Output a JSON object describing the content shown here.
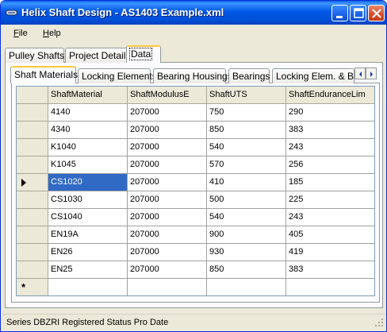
{
  "window": {
    "title": "Helix Shaft Design - AS1403 Example.xml"
  },
  "menu": [
    {
      "underline": "F",
      "rest": "ile"
    },
    {
      "underline": "H",
      "rest": "elp"
    }
  ],
  "outer_tabs": [
    {
      "label": "Pulley Shafts",
      "active": false
    },
    {
      "label": "Project Details",
      "active": false
    },
    {
      "label": "Data",
      "active": true
    }
  ],
  "inner_tabs": [
    {
      "label": "Shaft Materials",
      "active": true
    },
    {
      "label": "Locking Elements",
      "active": false
    },
    {
      "label": "Bearing Housings",
      "active": false
    },
    {
      "label": "Bearings",
      "active": false
    },
    {
      "label": "Locking Elem. & Brg",
      "active": false
    }
  ],
  "grid": {
    "columns": [
      "ShaftMaterial",
      "ShaftModulusE",
      "ShaftUTS",
      "ShaftEnduranceLim"
    ],
    "rows": [
      [
        "4140",
        "207000",
        "750",
        "290"
      ],
      [
        "4340",
        "207000",
        "850",
        "383"
      ],
      [
        "K1040",
        "207000",
        "540",
        "243"
      ],
      [
        "K1045",
        "207000",
        "570",
        "256"
      ],
      [
        "CS1020",
        "207000",
        "410",
        "185"
      ],
      [
        "CS1030",
        "207000",
        "500",
        "225"
      ],
      [
        "CS1040",
        "207000",
        "540",
        "243"
      ],
      [
        "EN19A",
        "207000",
        "900",
        "405"
      ],
      [
        "EN26",
        "207000",
        "930",
        "419"
      ],
      [
        "EN25",
        "207000",
        "850",
        "383"
      ]
    ],
    "current_row": 4,
    "selected_cell": [
      4,
      0
    ]
  },
  "status": {
    "text": "Series DBZRI  Registered  Status  Pro  Date"
  },
  "colors": {
    "title_bar": "#0058e6",
    "selection": "#316ac5",
    "tab_highlight": "#ffc83c"
  }
}
